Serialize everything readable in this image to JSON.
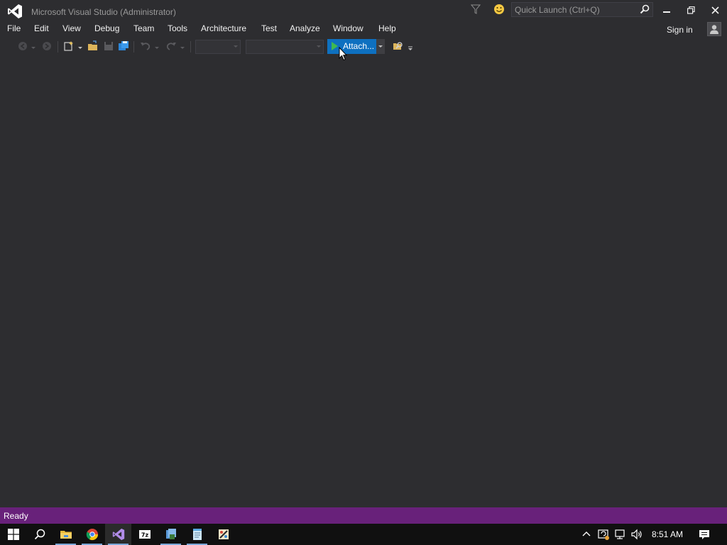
{
  "window": {
    "title": "Microsoft Visual Studio (Administrator)"
  },
  "quick_launch": {
    "placeholder": "Quick Launch (Ctrl+Q)"
  },
  "menu": {
    "items": [
      {
        "label": "File"
      },
      {
        "label": "Edit"
      },
      {
        "label": "View"
      },
      {
        "label": "Debug"
      },
      {
        "label": "Team"
      },
      {
        "label": "Tools"
      },
      {
        "label": "Architecture"
      },
      {
        "label": "Test"
      },
      {
        "label": "Analyze"
      },
      {
        "label": "Window"
      },
      {
        "label": "Help"
      }
    ],
    "sign_in": "Sign in"
  },
  "toolbar": {
    "attach_label": "Attach..."
  },
  "status": {
    "text": "Ready"
  },
  "taskbar": {
    "clock": "8:51 AM"
  },
  "colors": {
    "background": "#2d2d30",
    "statusbar": "#68217a",
    "accent": "#0e70c0",
    "vs_logo": "#ffffff"
  }
}
